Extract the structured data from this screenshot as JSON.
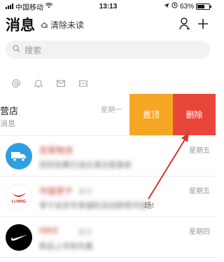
{
  "status_bar": {
    "carrier": "中国移动",
    "time": "13:13",
    "battery_text": "63%",
    "battery_level": 0.63
  },
  "header": {
    "title": "消息",
    "clear_unread": "清除未读"
  },
  "search": {
    "placeholder": "搜索"
  },
  "quick_icons": [
    "at-icon",
    "bell-icon",
    "mail-icon",
    "coupon-icon"
  ],
  "swiped_row": {
    "name": "营店",
    "preview": "消息",
    "time": "星期一",
    "pin_label": "置顶",
    "delete_label": "删除"
  },
  "conversations": [
    {
      "name": "百草物流",
      "tag": "",
      "preview": "您的包裹已送达请注意查收",
      "preview_tail": "",
      "time": "星期五",
      "avatar": "truck-icon"
    },
    {
      "name": "中国李宁",
      "tag": "官方",
      "preview": "李宁会员专享福利活动即将开启",
      "preview_tail": "场!",
      "time": "星期五",
      "avatar": "lining-logo"
    },
    {
      "name": "NIKE",
      "tag": "官方",
      "preview": "新品上市抢先看",
      "preview_tail": "",
      "time": "星期四",
      "avatar": "nike-logo"
    }
  ],
  "colors": {
    "pin": "#f5a623",
    "delete": "#e8463a",
    "arrow": "#d9342b",
    "truck_avatar": "#2f9fe3"
  }
}
